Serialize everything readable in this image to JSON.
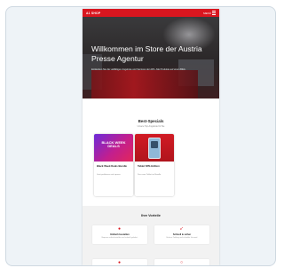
{
  "header": {
    "logo": "A1 SHOP",
    "menu_label": "MENÜ"
  },
  "hero": {
    "title": "Willkommen im Store der Austria Presse Agentur",
    "subtitle": "Entdecken Sie die vielfältigen Angebote und Services der APA. Alle Produkte auf einen Blick."
  },
  "specials": {
    "title": "Best-Specials",
    "subtitle": "Unsere Top-Angebote für Sie",
    "cards": [
      {
        "promo": "BLACK WEEK DEALS",
        "title": "Black Week Deals Bundle",
        "desc": "Jetzt profitieren und sparen."
      },
      {
        "promo": "",
        "title": "Tablet SPE-Edition",
        "desc": "Das neue Tablet im Bundle."
      }
    ]
  },
  "advantages": {
    "title": "Ihre Vorteile",
    "items": [
      {
        "icon": "shopping-icon",
        "label": "Einfach bestellen",
        "desc": "Bequem online bestellen und schnell geliefert."
      },
      {
        "icon": "rocket-icon",
        "label": "Schnell & sicher",
        "desc": "Sichere Zahlung und schneller Versand."
      },
      {
        "icon": "pin-icon",
        "label": "",
        "desc": ""
      },
      {
        "icon": "star-icon",
        "label": "",
        "desc": ""
      }
    ]
  },
  "colors": {
    "brand": "#d9161f",
    "background": "#eef3f7"
  }
}
